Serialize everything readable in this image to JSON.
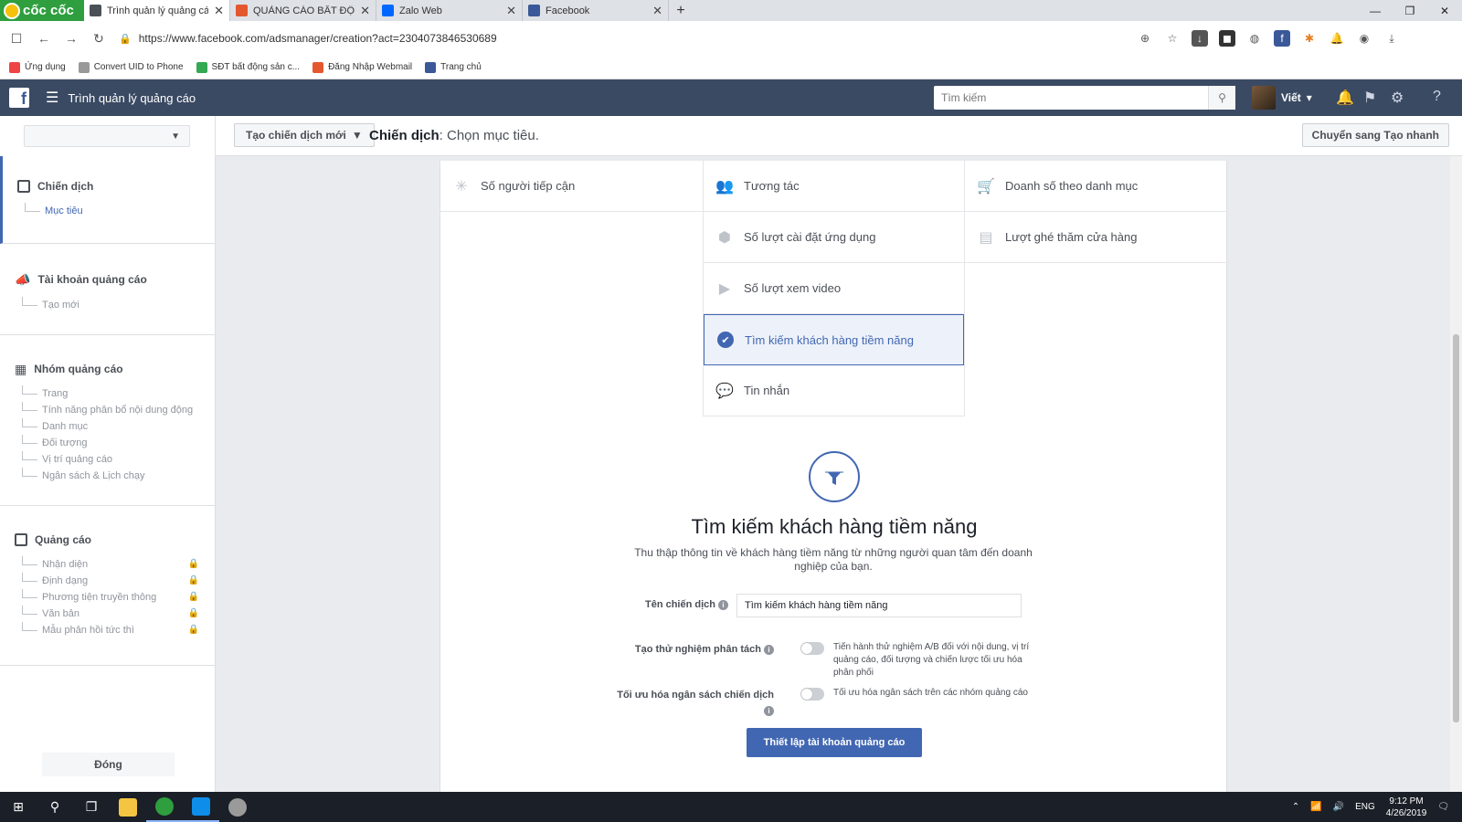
{
  "browser": {
    "brand": "cốc cốc",
    "tabs": [
      {
        "title": "Trình quản lý quảng cáo",
        "active": true,
        "color": "#4b4f56"
      },
      {
        "title": "QUẢNG CÁO BẤT ĐỘNG",
        "active": false,
        "color": "#e4572e"
      },
      {
        "title": "Zalo Web",
        "active": false,
        "color": "#0068ff"
      },
      {
        "title": "Facebook",
        "active": false,
        "color": "#3b5998"
      }
    ],
    "url": "https://www.facebook.com/adsmanager/creation?act=2304073846530689",
    "bookmarks": [
      {
        "label": "Ứng dụng",
        "color": "#e44"
      },
      {
        "label": "Convert UID to Phone",
        "color": "#999"
      },
      {
        "label": "SĐT bất động sản c...",
        "color": "#34a853"
      },
      {
        "label": "Đăng Nhập Webmail",
        "color": "#e4572e"
      },
      {
        "label": "Trang chủ",
        "color": "#3b5998"
      }
    ]
  },
  "header": {
    "title": "Trình quản lý quảng cáo",
    "search_placeholder": "Tìm kiếm",
    "user_name": "Viết"
  },
  "sidebar": {
    "sections": [
      {
        "title": "Chiến dịch",
        "items": [
          {
            "label": "Mục tiêu",
            "selected": true
          }
        ]
      },
      {
        "title": "Tài khoản quảng cáo",
        "items": [
          {
            "label": "Tạo mới"
          }
        ]
      },
      {
        "title": "Nhóm quảng cáo",
        "items": [
          {
            "label": "Trang"
          },
          {
            "label": "Tính năng phân bổ nội dung động"
          },
          {
            "label": "Danh mục"
          },
          {
            "label": "Đối tượng"
          },
          {
            "label": "Vị trí quảng cáo"
          },
          {
            "label": "Ngân sách & Lịch chạy"
          }
        ]
      },
      {
        "title": "Quảng cáo",
        "items": [
          {
            "label": "Nhận diện",
            "locked": true
          },
          {
            "label": "Định dạng",
            "locked": true
          },
          {
            "label": "Phương tiện truyền thông",
            "locked": true
          },
          {
            "label": "Văn bản",
            "locked": true
          },
          {
            "label": "Mẫu phản hồi tức thì",
            "locked": true
          }
        ]
      }
    ],
    "close_label": "Đóng"
  },
  "toolbar": {
    "new_campaign_label": "Tạo chiến dịch mới",
    "crumb_bold": "Chiến dịch",
    "crumb_rest": ": Chọn mục tiêu.",
    "quick_switch_label": "Chuyển sang Tạo nhanh"
  },
  "objectives": {
    "col1": [
      {
        "label": "Số người tiếp cận",
        "icon": "asterisk-icon"
      }
    ],
    "col2": [
      {
        "label": "Tương tác",
        "icon": "people-icon"
      },
      {
        "label": "Số lượt cài đặt ứng dụng",
        "icon": "box-icon"
      },
      {
        "label": "Số lượt xem video",
        "icon": "video-icon"
      },
      {
        "label": "Tìm kiếm khách hàng tiềm năng",
        "icon": "check-icon",
        "selected": true
      },
      {
        "label": "Tin nhắn",
        "icon": "chat-icon"
      }
    ],
    "col3": [
      {
        "label": "Doanh số theo danh mục",
        "icon": "cart-icon"
      },
      {
        "label": "Lượt ghé thăm cửa hàng",
        "icon": "store-icon"
      }
    ]
  },
  "detail": {
    "title": "Tìm kiếm khách hàng tiềm năng",
    "description": "Thu thập thông tin về khách hàng tiềm năng từ những người quan tâm đến doanh nghiệp của bạn.",
    "name_label": "Tên chiến dịch",
    "name_value": "Tìm kiếm khách hàng tiềm năng",
    "split_label": "Tạo thử nghiệm phân tách",
    "split_desc": "Tiến hành thử nghiệm A/B đối với nội dung, vị trí quảng cáo, đối tượng và chiến lược tối ưu hóa phân phối",
    "budget_label": "Tối ưu hóa ngân sách chiến dịch",
    "budget_desc": "Tối ưu hóa ngân sách trên các nhóm quảng cáo",
    "setup_button": "Thiết lập tài khoản quảng cáo"
  },
  "taskbar": {
    "lang": "ENG",
    "time": "9:12 PM",
    "date": "4/26/2019"
  }
}
